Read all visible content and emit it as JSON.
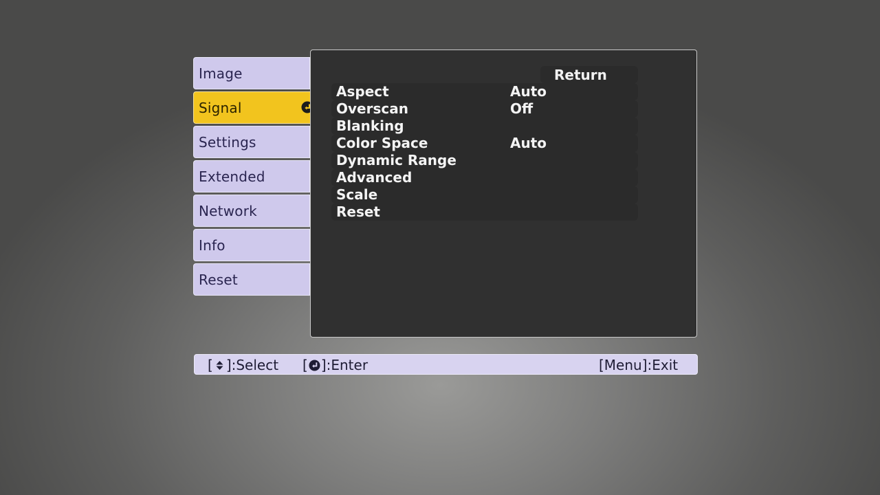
{
  "tabs": [
    {
      "label": "Image",
      "active": false
    },
    {
      "label": "Signal",
      "active": true
    },
    {
      "label": "Settings",
      "active": false
    },
    {
      "label": "Extended",
      "active": false
    },
    {
      "label": "Network",
      "active": false
    },
    {
      "label": "Info",
      "active": false
    },
    {
      "label": "Reset",
      "active": false
    }
  ],
  "panel": {
    "return_label": "Return",
    "items": [
      {
        "label": "Aspect",
        "value": "Auto"
      },
      {
        "label": "Overscan",
        "value": "Off"
      },
      {
        "label": "Blanking",
        "value": ""
      },
      {
        "label": "Color Space",
        "value": "Auto"
      },
      {
        "label": "Dynamic Range",
        "value": ""
      },
      {
        "label": "Advanced",
        "value": ""
      },
      {
        "label": "Scale",
        "value": ""
      },
      {
        "label": "Reset",
        "value": ""
      }
    ]
  },
  "helpbar": {
    "select_open": "[",
    "select_close": "]:Select",
    "enter_open": "[",
    "enter_close": "]:Enter",
    "exit": "[Menu]:Exit"
  },
  "icons": {
    "active_tab_icon": "enter-icon",
    "select_icon": "up-down-arrow-icon",
    "enter_icon": "enter-icon"
  },
  "colors": {
    "active_tab": "#f2c41e",
    "inactive_tab": "#cfc9ec",
    "panel": "#303030",
    "helpbar": "#d8d3f0"
  }
}
